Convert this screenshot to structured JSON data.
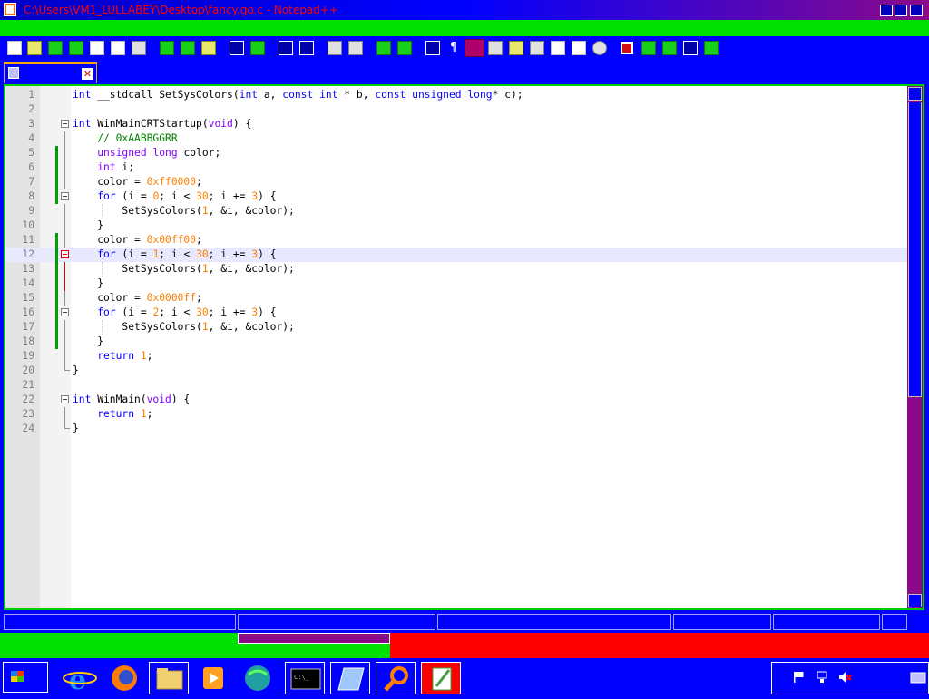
{
  "window": {
    "title": "C:\\Users\\VM1_LULLABEY\\Desktop\\fancy.go.c - Notepad++"
  },
  "tab": {
    "label": ""
  },
  "code_lines": [
    {
      "num": "1",
      "html": "<span class='kw'>int</span> __stdcall SetSysColors(<span class='kw'>int</span> a, <span class='kw'>const</span> <span class='kw'>int</span> * b, <span class='kw'>const</span> <span class='kw'>unsigned</span> <span class='kw'>long</span>* c);"
    },
    {
      "num": "2",
      "html": ""
    },
    {
      "num": "3",
      "html": "<span class='kw'>int</span> WinMainCRTStartup(<span class='ty'>void</span>) {"
    },
    {
      "num": "4",
      "html": "    <span class='cm'>// 0xAABBGGRR</span>"
    },
    {
      "num": "5",
      "html": "    <span class='ty'>unsigned</span> <span class='ty'>long</span> color;"
    },
    {
      "num": "6",
      "html": "    <span class='ty'>int</span> i;"
    },
    {
      "num": "7",
      "html": "    color = <span class='num'>0xff0000</span>;"
    },
    {
      "num": "8",
      "html": "    <span class='kw'>for</span> (i = <span class='num'>0</span>; i &lt; <span class='num'>30</span>; i += <span class='num'>3</span>) {"
    },
    {
      "num": "9",
      "html": "        SetSysColors(<span class='num'>1</span>, &amp;i, &amp;color);"
    },
    {
      "num": "10",
      "html": "    }"
    },
    {
      "num": "11",
      "html": "    color = <span class='num'>0x00ff00</span>;"
    },
    {
      "num": "12",
      "html": "    <span class='kw'>for</span> (i = <span class='num'>1</span>; i &lt; <span class='num'>30</span>; i += <span class='num'>3</span>) {"
    },
    {
      "num": "13",
      "html": "        SetSysColors(<span class='num'>1</span>, &amp;i, &amp;color);"
    },
    {
      "num": "14",
      "html": "    }"
    },
    {
      "num": "15",
      "html": "    color = <span class='num'>0x0000ff</span>;"
    },
    {
      "num": "16",
      "html": "    <span class='kw'>for</span> (i = <span class='num'>2</span>; i &lt; <span class='num'>30</span>; i += <span class='num'>3</span>) {"
    },
    {
      "num": "17",
      "html": "        SetSysColors(<span class='num'>1</span>, &amp;i, &amp;color);"
    },
    {
      "num": "18",
      "html": "    }"
    },
    {
      "num": "19",
      "html": "    <span class='kw'>return</span> <span class='num'>1</span>;"
    },
    {
      "num": "20",
      "html": "}"
    },
    {
      "num": "21",
      "html": ""
    },
    {
      "num": "22",
      "html": "<span class='kw'>int</span> WinMain(<span class='ty'>void</span>) {"
    },
    {
      "num": "23",
      "html": "    <span class='kw'>return</span> <span class='num'>1</span>;"
    },
    {
      "num": "24",
      "html": "}"
    }
  ],
  "current_line": "12",
  "toolbar": {
    "pilcrow": "¶"
  },
  "taskbar": {
    "apps": [
      "internet-explorer-icon",
      "firefox-icon",
      "file-explorer-icon",
      "media-player-icon",
      "browser-globe-icon",
      "command-prompt-icon",
      "notepad-app-icon",
      "search-magnifier-icon",
      "notepadpp-icon"
    ],
    "cmd_label": "C:\\_"
  },
  "colors": {
    "titlebar_text": "#ff0000",
    "keyword": "#0000ff",
    "type": "#8000ff",
    "number": "#ff8000",
    "comment": "#008000",
    "accent_green": "#00e000",
    "accent_red": "#ff0000",
    "accent_magenta": "#8a0a8a"
  }
}
